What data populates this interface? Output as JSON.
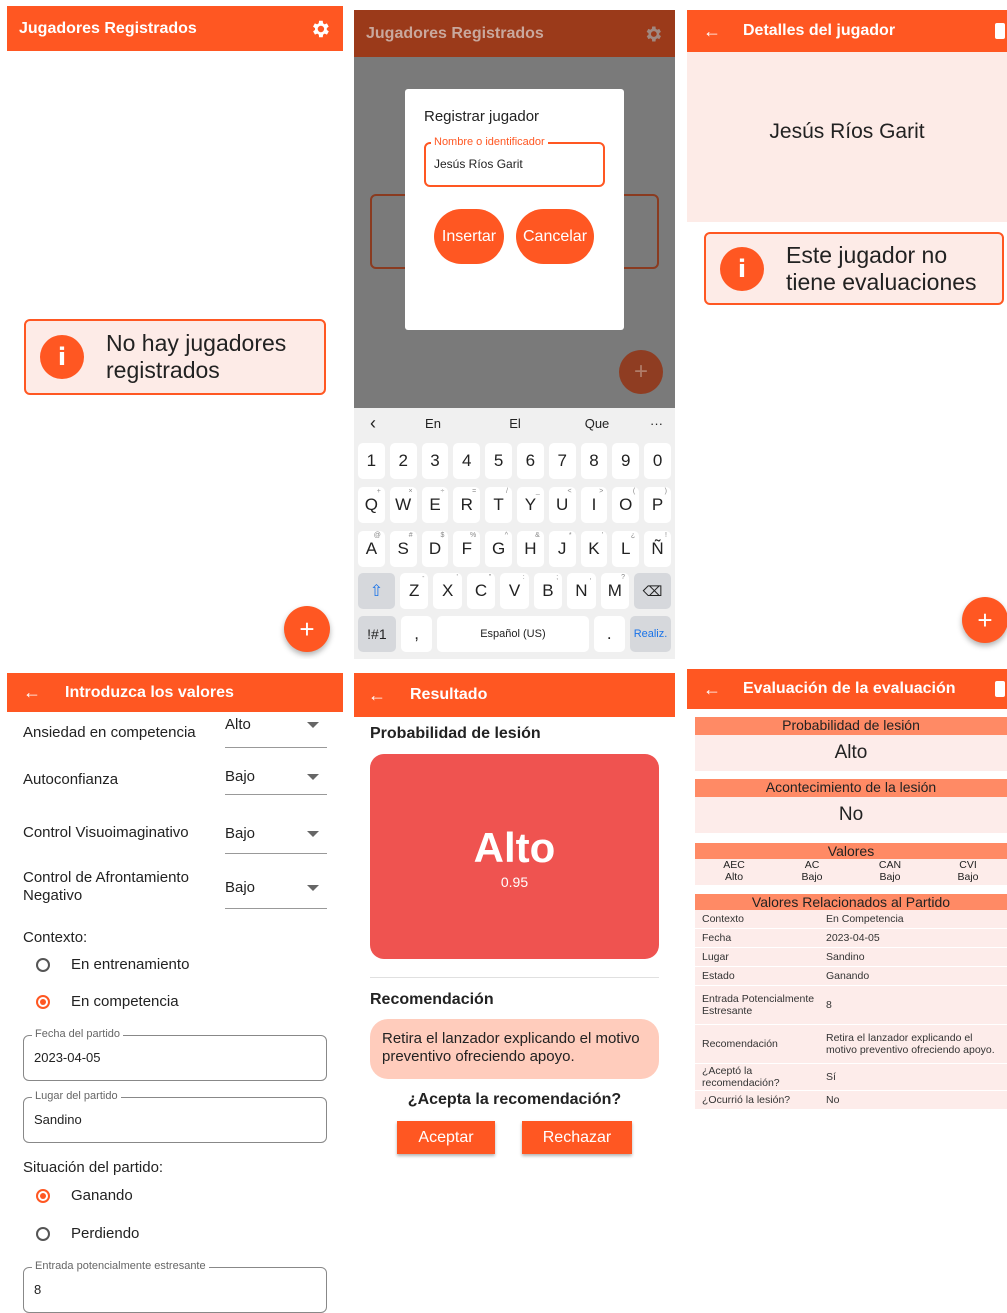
{
  "colors": {
    "accent": "#ff5722",
    "accent_light": "#ff8a65",
    "info_bg": "#fdebe7",
    "result_red": "#ef5350",
    "reco_bg": "#ffccbc"
  },
  "screen1": {
    "title": "Jugadores Registrados",
    "settings_icon": "gear-icon",
    "empty_message": "No hay jugadores registrados",
    "fab": "+"
  },
  "screen2": {
    "title": "Jugadores Registrados",
    "dialog": {
      "title": "Registrar jugador",
      "field_label": "Nombre o identificador",
      "field_value": "Jesús Ríos Garit",
      "insert": "Insertar",
      "cancel": "Cancelar"
    },
    "fab": "+",
    "keyboard": {
      "suggestions": [
        "En",
        "El",
        "Que"
      ],
      "more": "···",
      "numbers": [
        "1",
        "2",
        "3",
        "4",
        "5",
        "6",
        "7",
        "8",
        "9",
        "0"
      ],
      "row1": [
        {
          "k": "Q",
          "s": "+"
        },
        {
          "k": "W",
          "s": "×"
        },
        {
          "k": "E",
          "s": "÷"
        },
        {
          "k": "R",
          "s": "="
        },
        {
          "k": "T",
          "s": "/"
        },
        {
          "k": "Y",
          "s": "_"
        },
        {
          "k": "U",
          "s": "<"
        },
        {
          "k": "I",
          "s": ">"
        },
        {
          "k": "O",
          "s": "("
        },
        {
          "k": "P",
          "s": ")"
        }
      ],
      "row2": [
        {
          "k": "A",
          "s": "@"
        },
        {
          "k": "S",
          "s": "#"
        },
        {
          "k": "D",
          "s": "$"
        },
        {
          "k": "F",
          "s": "%"
        },
        {
          "k": "G",
          "s": "^"
        },
        {
          "k": "H",
          "s": "&"
        },
        {
          "k": "J",
          "s": "*"
        },
        {
          "k": "K",
          "s": "'"
        },
        {
          "k": "L",
          "s": "¿"
        },
        {
          "k": "Ñ",
          "s": "!"
        }
      ],
      "row3": [
        {
          "k": "Z",
          "s": "-"
        },
        {
          "k": "X",
          "s": "'"
        },
        {
          "k": "C",
          "s": "\""
        },
        {
          "k": "V",
          "s": ":"
        },
        {
          "k": "B",
          "s": ";"
        },
        {
          "k": "N",
          "s": ","
        },
        {
          "k": "M",
          "s": "?"
        }
      ],
      "symbols": "!#1",
      "comma": ",",
      "space": "Español (US)",
      "period": ".",
      "done": "Realiz."
    }
  },
  "screen3": {
    "title": "Detalles del jugador",
    "player_name": "Jesús Ríos Garit",
    "empty_message": "Este jugador no tiene evaluaciones",
    "fab": "+"
  },
  "screen4": {
    "title": "Introduzca los valores",
    "dropdowns": [
      {
        "label": "Ansiedad en competencia",
        "value": "Alto"
      },
      {
        "label": "Autoconfianza",
        "value": "Bajo"
      },
      {
        "label": "Control Visuoimaginativo",
        "value": "Bajo"
      },
      {
        "label": "Control de Afrontamiento Negativo",
        "value": "Bajo"
      }
    ],
    "context_label": "Contexto:",
    "context_options": [
      {
        "label": "En entrenamiento",
        "selected": false
      },
      {
        "label": "En competencia",
        "selected": true
      }
    ],
    "date_label": "Fecha del partido",
    "date_value": "2023-04-05",
    "place_label": "Lugar del partido",
    "place_value": "Sandino",
    "situation_label": "Situación del partido:",
    "situation_options": [
      {
        "label": "Ganando",
        "selected": true
      },
      {
        "label": "Perdiendo",
        "selected": false
      }
    ],
    "stress_label": "Entrada potencialmente estresante",
    "stress_value": "8"
  },
  "screen5": {
    "title": "Resultado",
    "prob_heading": "Probabilidad de lesión",
    "prob_value": "Alto",
    "prob_number": "0.95",
    "reco_heading": "Recomendación",
    "reco_text": "Retira el lanzador explicando el motivo preventivo ofreciendo apoyo.",
    "question": "¿Acepta la recomendación?",
    "accept": "Aceptar",
    "reject": "Rechazar"
  },
  "screen6": {
    "title": "Evaluación de la evaluación",
    "prob_head": "Probabilidad de lesión",
    "prob_value": "Alto",
    "event_head": "Acontecimiento de la lesión",
    "event_value": "No",
    "values_head": "Valores",
    "values_cols": [
      {
        "k": "AEC",
        "v": "Alto"
      },
      {
        "k": "AC",
        "v": "Bajo"
      },
      {
        "k": "CAN",
        "v": "Bajo"
      },
      {
        "k": "CVI",
        "v": "Bajo"
      }
    ],
    "match_head": "Valores Relacionados al Partido",
    "rows": [
      {
        "k": "Contexto",
        "v": "En Competencia"
      },
      {
        "k": "Fecha",
        "v": "2023-04-05"
      },
      {
        "k": "Lugar",
        "v": "Sandino"
      },
      {
        "k": "Estado",
        "v": "Ganando"
      },
      {
        "k": "Entrada Potencialmente Estresante",
        "v": "8"
      },
      {
        "k": "Recomendación",
        "v": "Retira el lanzador explicando el motivo preventivo ofreciendo apoyo."
      },
      {
        "k": "¿Aceptó la recomendación?",
        "v": "Sí"
      },
      {
        "k": "¿Ocurrió la lesión?",
        "v": "No"
      }
    ]
  }
}
